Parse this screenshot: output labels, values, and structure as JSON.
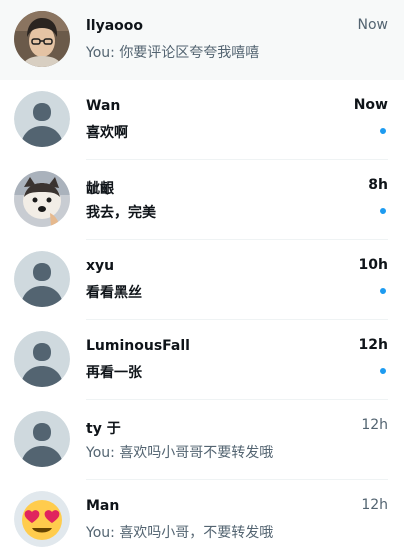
{
  "conversations": [
    {
      "name": "llyaooo",
      "time": "Now",
      "you_prefix": "You:",
      "preview": "你要评论区夸夸我嘻嘻",
      "unread": false,
      "active": true,
      "avatar": "photo-person-icon"
    },
    {
      "name": "Wan",
      "time": "Now",
      "you_prefix": "",
      "preview": "喜欢啊",
      "unread": true,
      "active": false,
      "avatar": "default-user-icon"
    },
    {
      "name": "龇齦",
      "time": "8h",
      "you_prefix": "",
      "preview": "我去，完美",
      "unread": true,
      "active": false,
      "avatar": "photo-dog-icon"
    },
    {
      "name": "xyu",
      "time": "10h",
      "you_prefix": "",
      "preview": "看看黑丝",
      "unread": true,
      "active": false,
      "avatar": "default-user-icon"
    },
    {
      "name": "LuminousFall",
      "time": "12h",
      "you_prefix": "",
      "preview": "再看一张",
      "unread": true,
      "active": false,
      "avatar": "default-user-icon"
    },
    {
      "name": "ty 于",
      "time": "12h",
      "you_prefix": "You:",
      "preview": "喜欢吗小哥哥不要转发哦",
      "unread": false,
      "active": false,
      "avatar": "default-user-icon"
    },
    {
      "name": "Man",
      "time": "12h",
      "you_prefix": "You:",
      "preview": "喜欢吗小哥，不要转发哦",
      "unread": false,
      "active": false,
      "avatar": "heart-eyes-emoji-icon"
    }
  ],
  "colors": {
    "unread_dot": "#1d9bf0",
    "default_avatar_bg": "#cfd9de",
    "default_avatar_fg": "#536471"
  }
}
